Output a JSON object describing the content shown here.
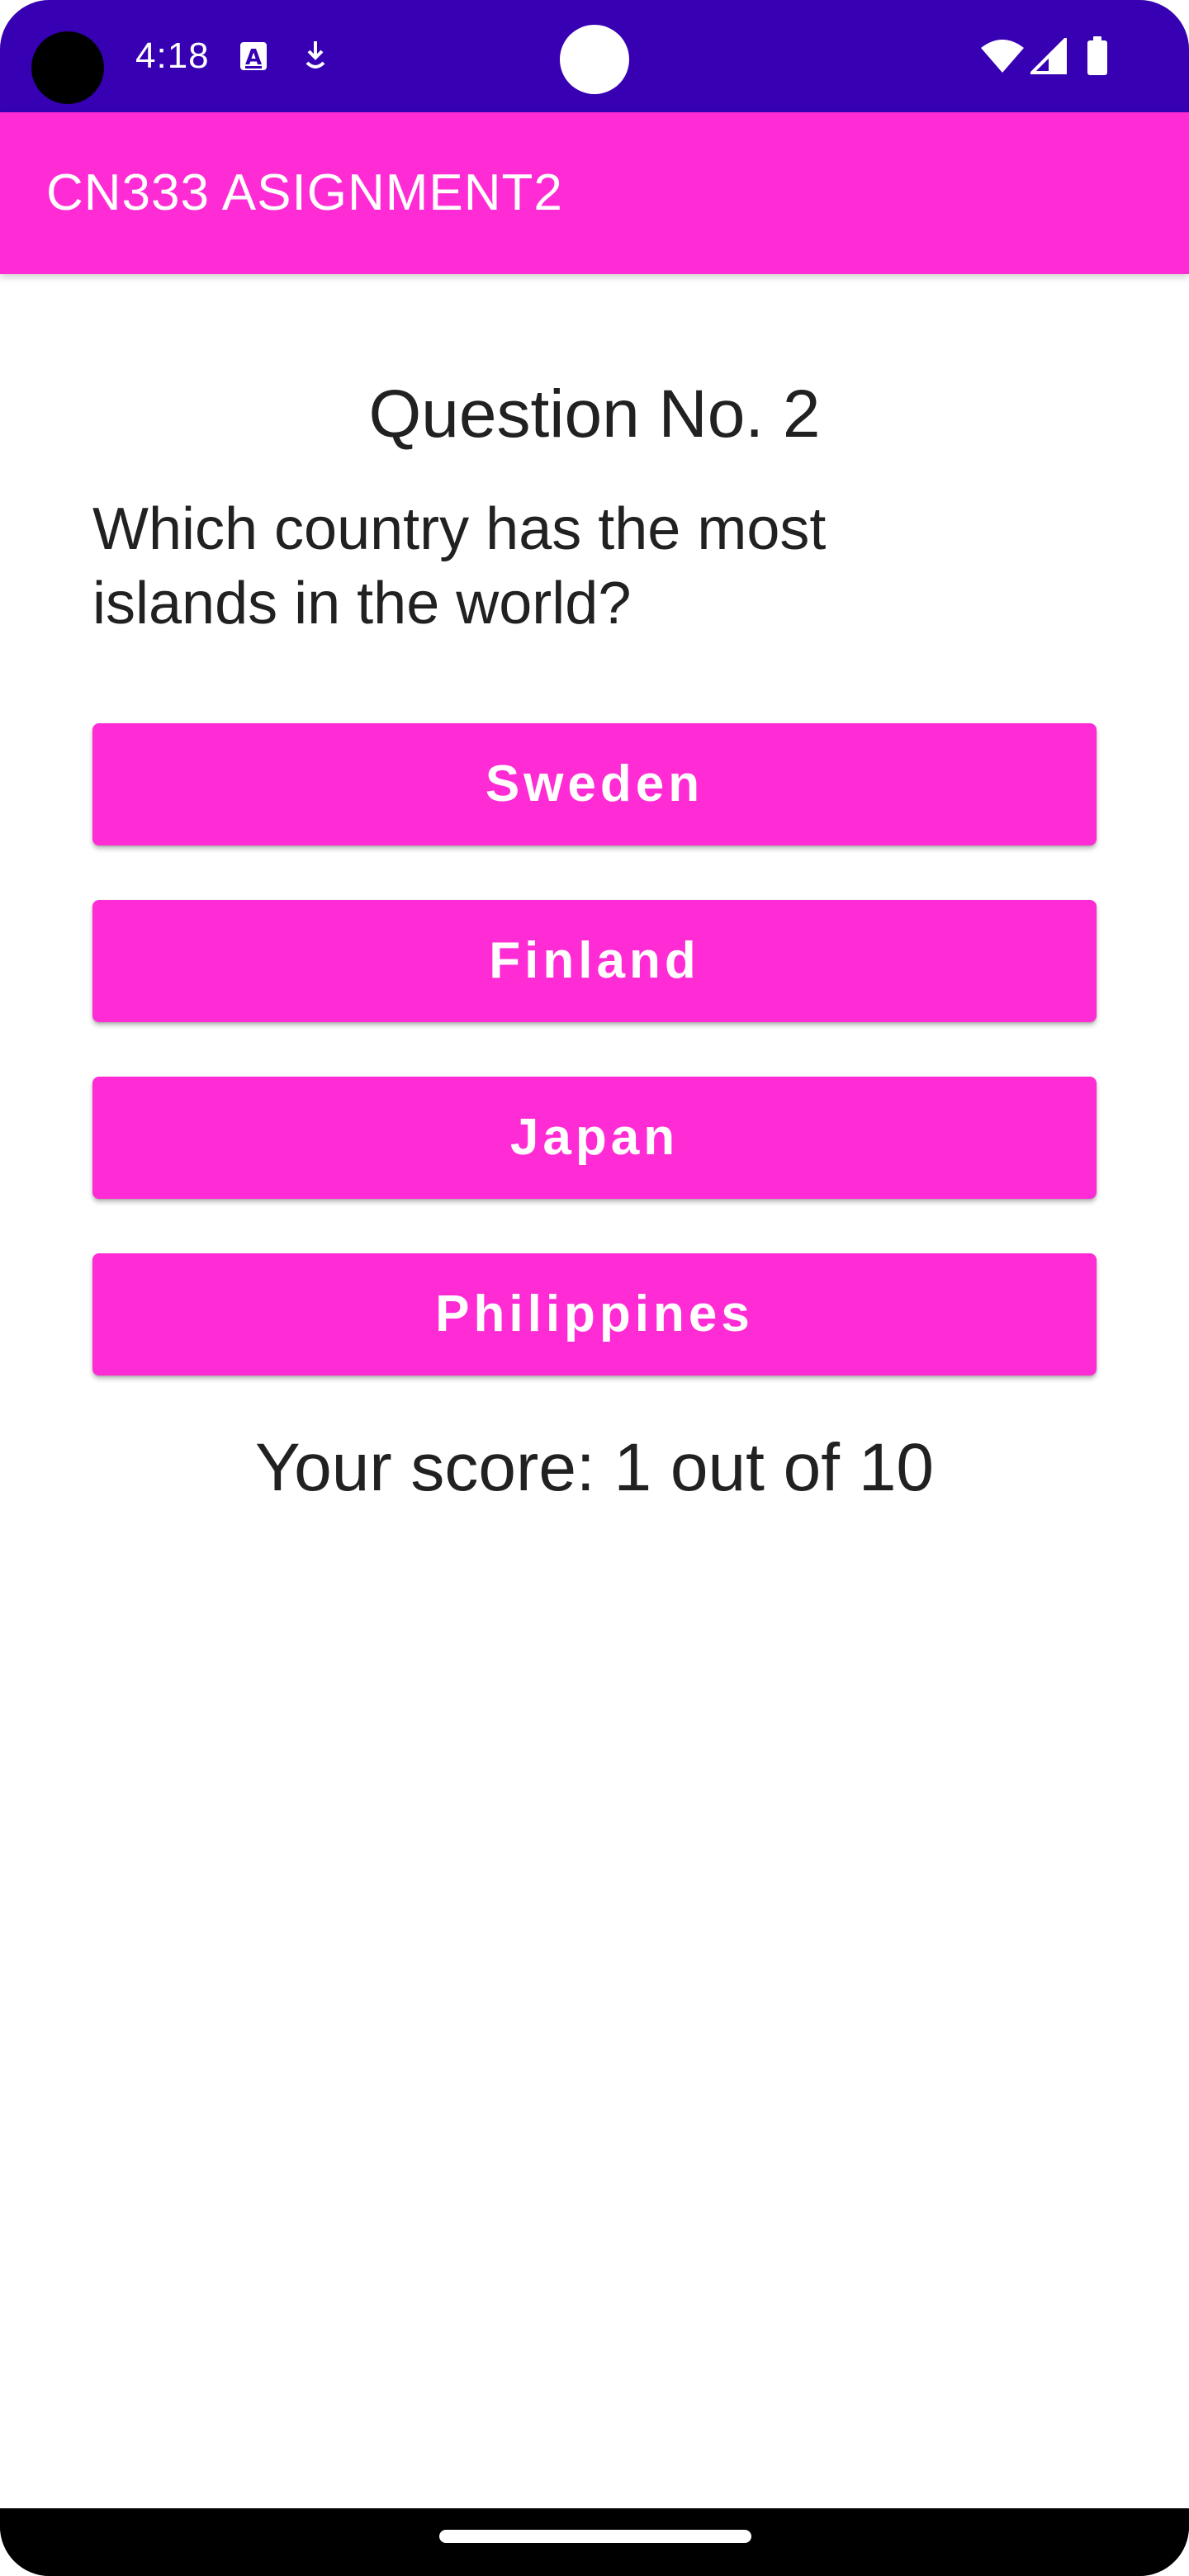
{
  "colors": {
    "status_bar": "#3700b3",
    "primary": "#ff2bd4",
    "on_primary": "#ffffff",
    "text": "#212121",
    "background": "#ffffff"
  },
  "status_bar": {
    "time": "4:18",
    "left_icons": [
      "camera-cutout",
      "a11y-a-icon",
      "download-arrow-icon"
    ],
    "right_icons": [
      "wifi-icon",
      "cell-signal-icon",
      "battery-icon"
    ]
  },
  "app_bar": {
    "title": "CN333 ASIGNMENT2"
  },
  "quiz": {
    "question_number": "Question No. 2",
    "question_text": "Which country has the most islands in the world?",
    "answers": [
      "Sweden",
      "Finland",
      "Japan",
      "Philippines"
    ],
    "score_text": "Your score: 1 out of 10"
  }
}
